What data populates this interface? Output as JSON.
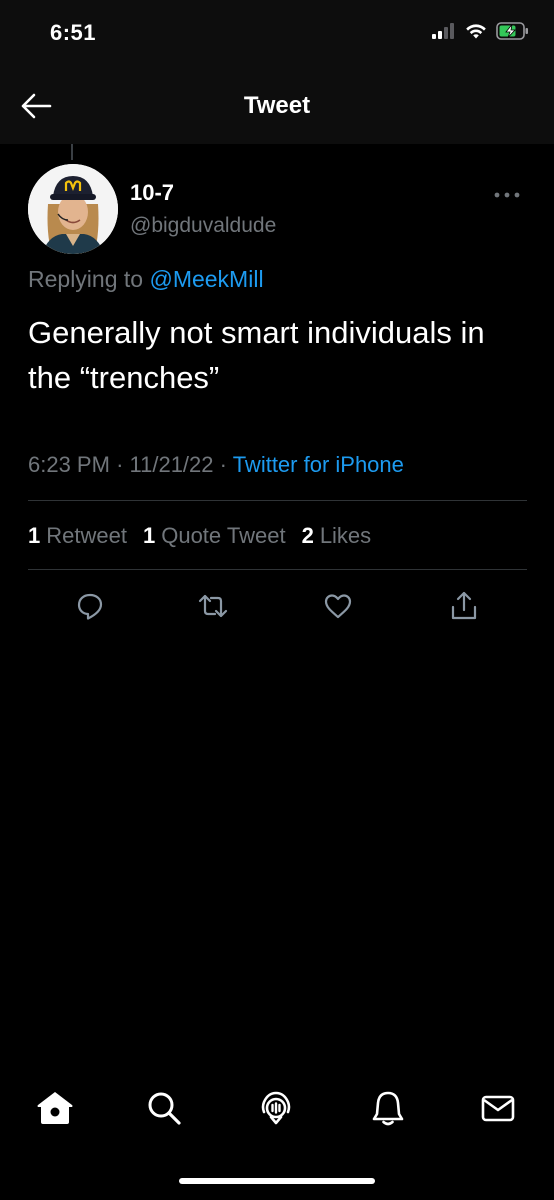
{
  "status_bar": {
    "time": "6:51",
    "icons": [
      "cellular-signal-icon",
      "wifi-icon",
      "battery-charging-icon"
    ]
  },
  "header": {
    "title": "Tweet",
    "back_icon": "back-arrow-icon"
  },
  "tweet": {
    "display_name": "10-7",
    "handle": "@bigduvaldude",
    "reply_prefix": "Replying to",
    "reply_to": "@MeekMill",
    "text": "Generally not smart individuals in the “trenches”",
    "time": "6:23 PM",
    "date": "11/21/22",
    "separator": "·",
    "source": "Twitter for iPhone",
    "stats": {
      "retweets_count": "1",
      "retweets_label": "Retweet",
      "quotes_count": "1",
      "quotes_label": "Quote Tweet",
      "likes_count": "2",
      "likes_label": "Likes"
    },
    "actions": [
      "reply-icon",
      "retweet-icon",
      "like-icon",
      "share-icon"
    ]
  },
  "tab_bar": {
    "items": [
      "home-icon",
      "search-icon",
      "spaces-icon",
      "notifications-icon",
      "messages-icon"
    ]
  },
  "colors": {
    "background": "#000000",
    "bar_background": "#0d0d0d",
    "text_primary": "#ffffff",
    "text_secondary": "#71767b",
    "accent": "#1d9bf0",
    "divider": "#2f3336",
    "battery_charging": "#34c759"
  }
}
